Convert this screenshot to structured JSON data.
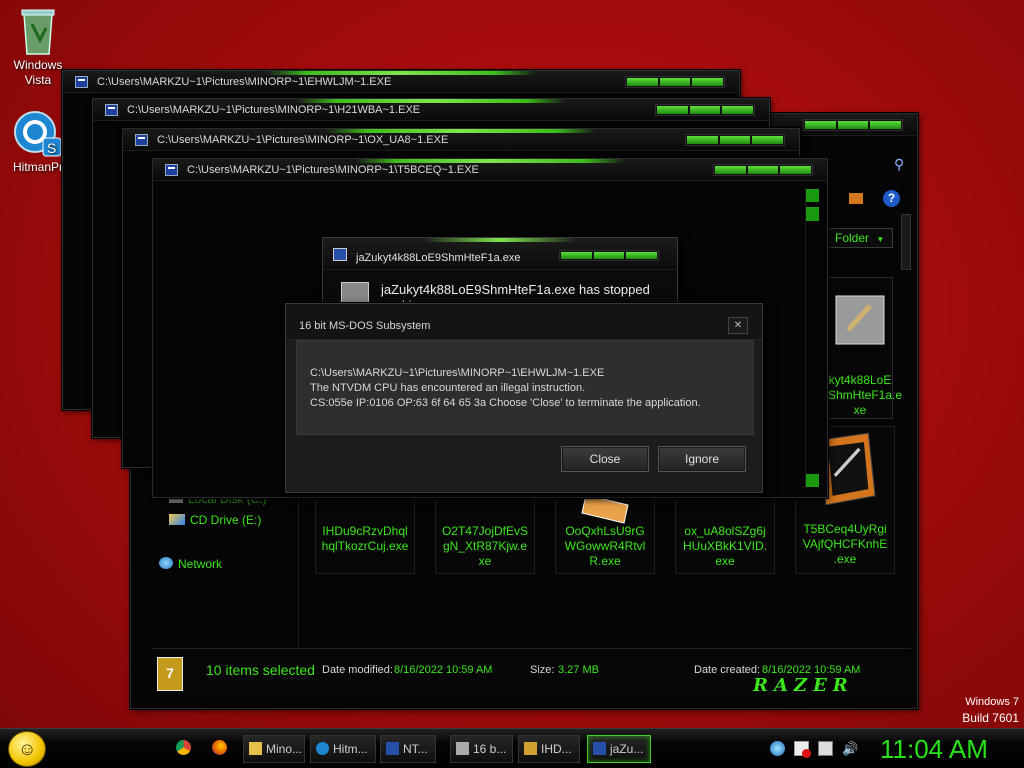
{
  "desktop": {
    "icons": [
      {
        "label": "Windows\nVista",
        "icon": "recycle-bin-icon"
      },
      {
        "label": "HitmanPr",
        "icon": "hitmanpro-icon"
      }
    ],
    "watermark": {
      "line1": "Windows 7",
      "line2": "Build 7601"
    }
  },
  "windows": [
    {
      "title": "C:\\Users\\MARKZU~1\\Pictures\\MINORP~1\\EHWLJM~1.EXE"
    },
    {
      "title": "C:\\Users\\MARKZU~1\\Pictures\\MINORP~1\\H21WBA~1.EXE"
    },
    {
      "title": "C:\\Users\\MARKZU~1\\Pictures\\MINORP~1\\OX_UA8~1.EXE"
    },
    {
      "title": "C:\\Users\\MARKZU~1\\Pictures\\MINORP~1\\T5BCEQ~1.EXE"
    }
  ],
  "explorer": {
    "folder_button": "Folder",
    "sidebar": [
      "Local Disk (C:)",
      "CD Drive (E:)",
      "Network"
    ],
    "files": [
      {
        "name": "IHDu9cRzvDhql\nhqlTkozrCuj.exe"
      },
      {
        "name": "O2T47JojDfEvS\ngN_XtR87Kjw.e\nxe"
      },
      {
        "name": "OoQxhLsU9rG\nWGowwR4Rtvl\nR.exe"
      },
      {
        "name": "ox_uA8olSZg6j\nHUuXBkK1VID.\nexe"
      },
      {
        "name": "T5BCeq4UyRgi\nVAjfQHCFKnhE\n.exe"
      },
      {
        "name": "kyt4k88LoE\nShmHteF1a.e\nxe"
      }
    ],
    "status": {
      "selected": "10 items selected",
      "modified_label": "Date modified:",
      "modified_value": "8/16/2022 10:59 AM",
      "size_label": "Size:",
      "size_value": "3.27 MB",
      "created_label": "Date created:",
      "created_value": "8/16/2022 10:59 AM"
    },
    "brand": "RAZER"
  },
  "stopped_dialog": {
    "title": "jaZukyt4k88LoE9ShmHteF1a.exe",
    "message": "jaZukyt4k88LoE9ShmHteF1a.exe has stopped working"
  },
  "ntvdm_dialog": {
    "title": "16 bit MS-DOS Subsystem",
    "line1": "C:\\Users\\MARKZU~1\\Pictures\\MINORP~1\\EHWLJM~1.EXE",
    "line2": "The NTVDM CPU has encountered an illegal instruction.",
    "line3": "CS:055e IP:0106 OP:63 6f 64 65 3a Choose 'Close' to terminate the application.",
    "close_label": "Close",
    "ignore_label": "Ignore",
    "close_icon": "✕"
  },
  "taskbar": {
    "items": [
      {
        "label": "Mino...",
        "icon": "folder-icon"
      },
      {
        "label": "Hitm...",
        "icon": "hitmanpro-icon"
      },
      {
        "label": "NT...",
        "icon": "console-icon"
      },
      {
        "label": "16 b...",
        "icon": "dos-icon"
      },
      {
        "label": "IHD...",
        "icon": "file-icon"
      },
      {
        "label": "jaZu...",
        "icon": "app-icon"
      }
    ],
    "clock": "11:04 AM"
  }
}
